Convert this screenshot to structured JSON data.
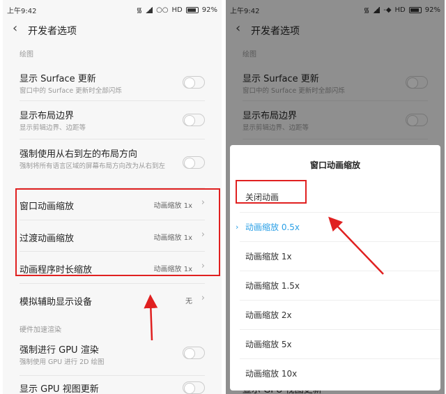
{
  "status": {
    "time": "上午9:42",
    "network": "HD",
    "battery": "92%"
  },
  "header": {
    "title": "开发者选项"
  },
  "sections": {
    "drawing": "绘图",
    "hw": "硬件加速渲染"
  },
  "settings": [
    {
      "title": "显示 Surface 更新",
      "sub": "窗口中的 Surface 更新时全部闪烁"
    },
    {
      "title": "显示布局边界",
      "sub": "显示剪辑边界、边距等"
    },
    {
      "title": "强制使用从右到左的布局方向",
      "sub": "强制将所有语言区域的屏幕布局方向改为从右到左"
    },
    {
      "title": "窗口动画缩放",
      "value": "动画缩放 1x"
    },
    {
      "title": "过渡动画缩放",
      "value": "动画缩放 1x"
    },
    {
      "title": "动画程序时长缩放",
      "value": "动画缩放 1x"
    },
    {
      "title": "模拟辅助显示设备",
      "value": "无"
    },
    {
      "title": "强制进行 GPU 渲染",
      "sub": "强制使用 GPU 进行 2D 绘图"
    },
    {
      "title": "显示 GPU 视图更新"
    }
  ],
  "dialog": {
    "title": "窗口动画缩放",
    "options": [
      "关闭动画",
      "动画缩放 0.5x",
      "动画缩放 1x",
      "动画缩放 1.5x",
      "动画缩放 2x",
      "动画缩放 5x",
      "动画缩放 10x"
    ],
    "selected_index": 1
  },
  "colors": {
    "accent": "#2ba0e6",
    "highlight": "#e02020"
  }
}
